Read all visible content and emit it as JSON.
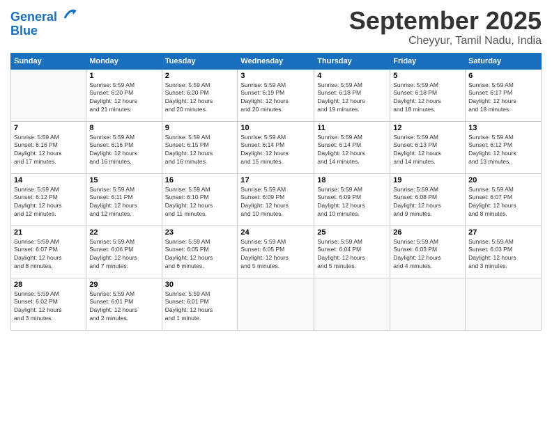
{
  "header": {
    "logo_line1": "General",
    "logo_line2": "Blue",
    "month_year": "September 2025",
    "location": "Cheyyur, Tamil Nadu, India"
  },
  "weekdays": [
    "Sunday",
    "Monday",
    "Tuesday",
    "Wednesday",
    "Thursday",
    "Friday",
    "Saturday"
  ],
  "weeks": [
    [
      {
        "day": "",
        "info": ""
      },
      {
        "day": "1",
        "info": "Sunrise: 5:59 AM\nSunset: 6:20 PM\nDaylight: 12 hours\nand 21 minutes."
      },
      {
        "day": "2",
        "info": "Sunrise: 5:59 AM\nSunset: 6:20 PM\nDaylight: 12 hours\nand 20 minutes."
      },
      {
        "day": "3",
        "info": "Sunrise: 5:59 AM\nSunset: 6:19 PM\nDaylight: 12 hours\nand 20 minutes."
      },
      {
        "day": "4",
        "info": "Sunrise: 5:59 AM\nSunset: 6:18 PM\nDaylight: 12 hours\nand 19 minutes."
      },
      {
        "day": "5",
        "info": "Sunrise: 5:59 AM\nSunset: 6:18 PM\nDaylight: 12 hours\nand 18 minutes."
      },
      {
        "day": "6",
        "info": "Sunrise: 5:59 AM\nSunset: 6:17 PM\nDaylight: 12 hours\nand 18 minutes."
      }
    ],
    [
      {
        "day": "7",
        "info": "Sunrise: 5:59 AM\nSunset: 6:16 PM\nDaylight: 12 hours\nand 17 minutes."
      },
      {
        "day": "8",
        "info": "Sunrise: 5:59 AM\nSunset: 6:16 PM\nDaylight: 12 hours\nand 16 minutes."
      },
      {
        "day": "9",
        "info": "Sunrise: 5:59 AM\nSunset: 6:15 PM\nDaylight: 12 hours\nand 16 minutes."
      },
      {
        "day": "10",
        "info": "Sunrise: 5:59 AM\nSunset: 6:14 PM\nDaylight: 12 hours\nand 15 minutes."
      },
      {
        "day": "11",
        "info": "Sunrise: 5:59 AM\nSunset: 6:14 PM\nDaylight: 12 hours\nand 14 minutes."
      },
      {
        "day": "12",
        "info": "Sunrise: 5:59 AM\nSunset: 6:13 PM\nDaylight: 12 hours\nand 14 minutes."
      },
      {
        "day": "13",
        "info": "Sunrise: 5:59 AM\nSunset: 6:12 PM\nDaylight: 12 hours\nand 13 minutes."
      }
    ],
    [
      {
        "day": "14",
        "info": "Sunrise: 5:59 AM\nSunset: 6:12 PM\nDaylight: 12 hours\nand 12 minutes."
      },
      {
        "day": "15",
        "info": "Sunrise: 5:59 AM\nSunset: 6:11 PM\nDaylight: 12 hours\nand 12 minutes."
      },
      {
        "day": "16",
        "info": "Sunrise: 5:59 AM\nSunset: 6:10 PM\nDaylight: 12 hours\nand 11 minutes."
      },
      {
        "day": "17",
        "info": "Sunrise: 5:59 AM\nSunset: 6:09 PM\nDaylight: 12 hours\nand 10 minutes."
      },
      {
        "day": "18",
        "info": "Sunrise: 5:59 AM\nSunset: 6:09 PM\nDaylight: 12 hours\nand 10 minutes."
      },
      {
        "day": "19",
        "info": "Sunrise: 5:59 AM\nSunset: 6:08 PM\nDaylight: 12 hours\nand 9 minutes."
      },
      {
        "day": "20",
        "info": "Sunrise: 5:59 AM\nSunset: 6:07 PM\nDaylight: 12 hours\nand 8 minutes."
      }
    ],
    [
      {
        "day": "21",
        "info": "Sunrise: 5:59 AM\nSunset: 6:07 PM\nDaylight: 12 hours\nand 8 minutes."
      },
      {
        "day": "22",
        "info": "Sunrise: 5:59 AM\nSunset: 6:06 PM\nDaylight: 12 hours\nand 7 minutes."
      },
      {
        "day": "23",
        "info": "Sunrise: 5:59 AM\nSunset: 6:05 PM\nDaylight: 12 hours\nand 6 minutes."
      },
      {
        "day": "24",
        "info": "Sunrise: 5:59 AM\nSunset: 6:05 PM\nDaylight: 12 hours\nand 5 minutes."
      },
      {
        "day": "25",
        "info": "Sunrise: 5:59 AM\nSunset: 6:04 PM\nDaylight: 12 hours\nand 5 minutes."
      },
      {
        "day": "26",
        "info": "Sunrise: 5:59 AM\nSunset: 6:03 PM\nDaylight: 12 hours\nand 4 minutes."
      },
      {
        "day": "27",
        "info": "Sunrise: 5:59 AM\nSunset: 6:03 PM\nDaylight: 12 hours\nand 3 minutes."
      }
    ],
    [
      {
        "day": "28",
        "info": "Sunrise: 5:59 AM\nSunset: 6:02 PM\nDaylight: 12 hours\nand 3 minutes."
      },
      {
        "day": "29",
        "info": "Sunrise: 5:59 AM\nSunset: 6:01 PM\nDaylight: 12 hours\nand 2 minutes."
      },
      {
        "day": "30",
        "info": "Sunrise: 5:59 AM\nSunset: 6:01 PM\nDaylight: 12 hours\nand 1 minute."
      },
      {
        "day": "",
        "info": ""
      },
      {
        "day": "",
        "info": ""
      },
      {
        "day": "",
        "info": ""
      },
      {
        "day": "",
        "info": ""
      }
    ]
  ]
}
